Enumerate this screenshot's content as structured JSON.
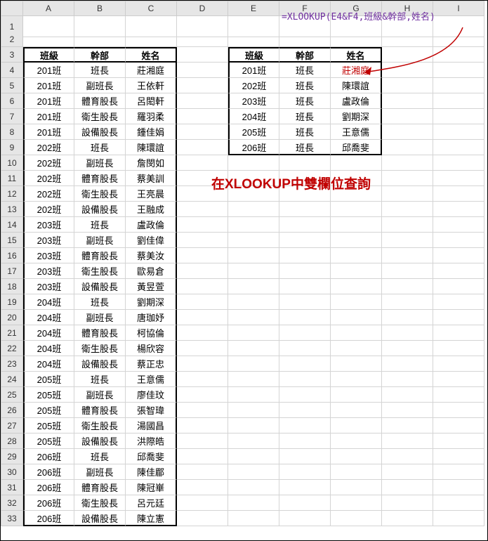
{
  "columns": [
    "A",
    "B",
    "C",
    "D",
    "E",
    "F",
    "G",
    "H",
    "I"
  ],
  "rows": [
    1,
    2,
    3,
    4,
    5,
    6,
    7,
    8,
    9,
    10,
    11,
    12,
    13,
    14,
    15,
    16,
    17,
    18,
    19,
    20,
    21,
    22,
    23,
    24,
    25,
    26,
    27,
    28,
    29,
    30,
    31,
    32,
    33
  ],
  "formula": "=XLOOKUP(E4&F4,班級&幹部,姓名)",
  "caption": "在XLOOKUP中雙欄位查詢",
  "leftTable": {
    "headers": [
      "班級",
      "幹部",
      "姓名"
    ],
    "rows": [
      [
        "201班",
        "班長",
        "莊湘庭"
      ],
      [
        "201班",
        "副班長",
        "王依軒"
      ],
      [
        "201班",
        "體育股長",
        "呂閎軒"
      ],
      [
        "201班",
        "衛生股長",
        "羅羽柔"
      ],
      [
        "201班",
        "設備股長",
        "鍾佳娟"
      ],
      [
        "202班",
        "班長",
        "陳環誼"
      ],
      [
        "202班",
        "副班長",
        "詹閔如"
      ],
      [
        "202班",
        "體育股長",
        "蔡美訓"
      ],
      [
        "202班",
        "衛生股長",
        "王亮晨"
      ],
      [
        "202班",
        "設備股長",
        "王融成"
      ],
      [
        "203班",
        "班長",
        "盧政倫"
      ],
      [
        "203班",
        "副班長",
        "劉佳偉"
      ],
      [
        "203班",
        "體育股長",
        "蔡美汝"
      ],
      [
        "203班",
        "衛生股長",
        "歐易倉"
      ],
      [
        "203班",
        "設備股長",
        "黃昱萱"
      ],
      [
        "204班",
        "班長",
        "劉期深"
      ],
      [
        "204班",
        "副班長",
        "唐珈妤"
      ],
      [
        "204班",
        "體育股長",
        "柯協倫"
      ],
      [
        "204班",
        "衛生股長",
        "楊欣容"
      ],
      [
        "204班",
        "設備股長",
        "蔡正忠"
      ],
      [
        "205班",
        "班長",
        "王意儒"
      ],
      [
        "205班",
        "副班長",
        "廖佳玟"
      ],
      [
        "205班",
        "體育股長",
        "張智瑋"
      ],
      [
        "205班",
        "衛生股長",
        "湯國昌"
      ],
      [
        "205班",
        "設備股長",
        "洪際皓"
      ],
      [
        "206班",
        "班長",
        "邱喬斐"
      ],
      [
        "206班",
        "副班長",
        "陳佳郿"
      ],
      [
        "206班",
        "體育股長",
        "陳冠崋"
      ],
      [
        "206班",
        "衛生股長",
        "呂元廷"
      ],
      [
        "206班",
        "設備股長",
        "陳立憲"
      ]
    ]
  },
  "rightTable": {
    "headers": [
      "班級",
      "幹部",
      "姓名"
    ],
    "rows": [
      [
        "201班",
        "班長",
        "莊湘庭"
      ],
      [
        "202班",
        "班長",
        "陳環誼"
      ],
      [
        "203班",
        "班長",
        "盧政倫"
      ],
      [
        "204班",
        "班長",
        "劉期深"
      ],
      [
        "205班",
        "班長",
        "王意儒"
      ],
      [
        "206班",
        "班長",
        "邱喬斐"
      ]
    ]
  }
}
